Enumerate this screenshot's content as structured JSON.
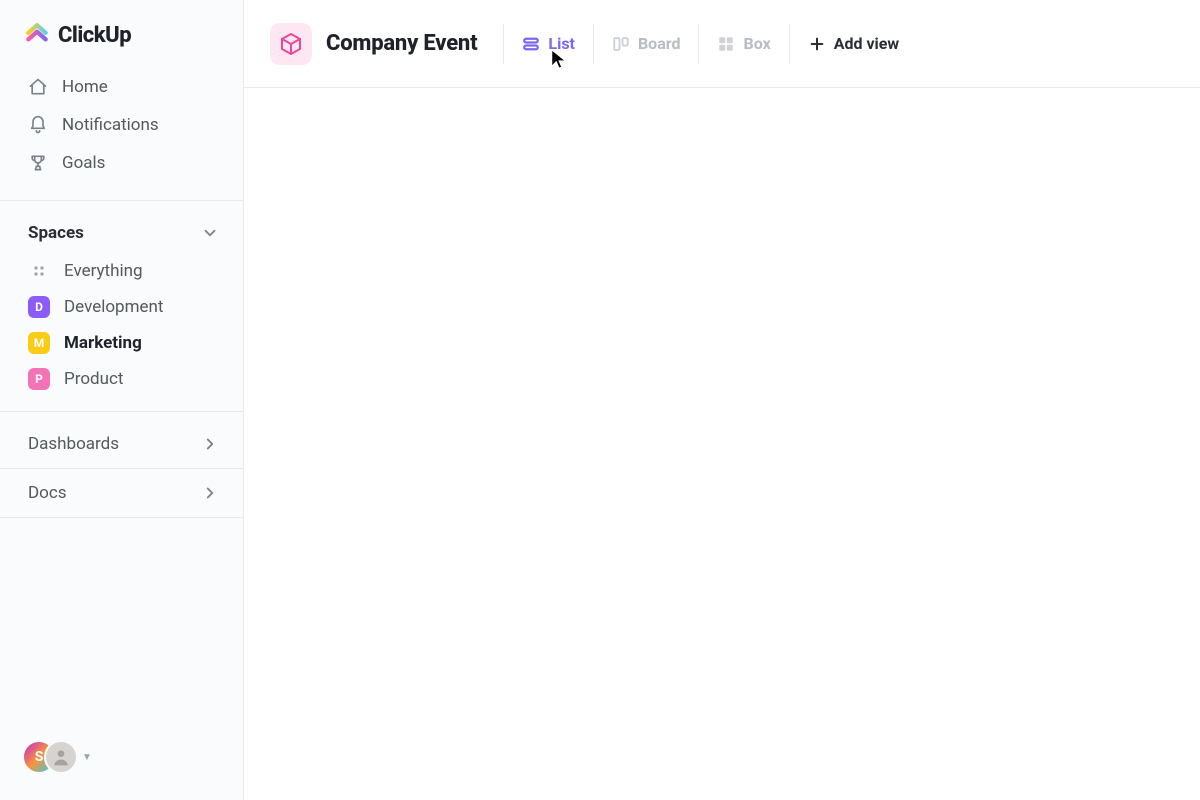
{
  "brand": {
    "name": "ClickUp"
  },
  "sidebar": {
    "nav": [
      {
        "label": "Home",
        "icon": "home"
      },
      {
        "label": "Notifications",
        "icon": "bell"
      },
      {
        "label": "Goals",
        "icon": "trophy"
      }
    ],
    "spaces_header": "Spaces",
    "spaces": [
      {
        "label": "Everything",
        "icon": "dots",
        "color": "#9ca3af",
        "initial": ""
      },
      {
        "label": "Development",
        "icon": "avatar",
        "color": "#8b5cf6",
        "initial": "D"
      },
      {
        "label": "Marketing",
        "icon": "avatar",
        "color": "#facc15",
        "initial": "M",
        "active": true
      },
      {
        "label": "Product",
        "icon": "avatar",
        "color": "#f472b6",
        "initial": "P"
      }
    ],
    "sections": [
      {
        "label": "Dashboards"
      },
      {
        "label": "Docs"
      }
    ],
    "presence": {
      "avatars": [
        "S",
        "·"
      ]
    }
  },
  "header": {
    "title": "Company Event",
    "views": [
      {
        "label": "List",
        "kind": "list",
        "active": true
      },
      {
        "label": "Board",
        "kind": "board",
        "active": false
      },
      {
        "label": "Box",
        "kind": "box",
        "active": false
      }
    ],
    "add_view_label": "Add view"
  }
}
